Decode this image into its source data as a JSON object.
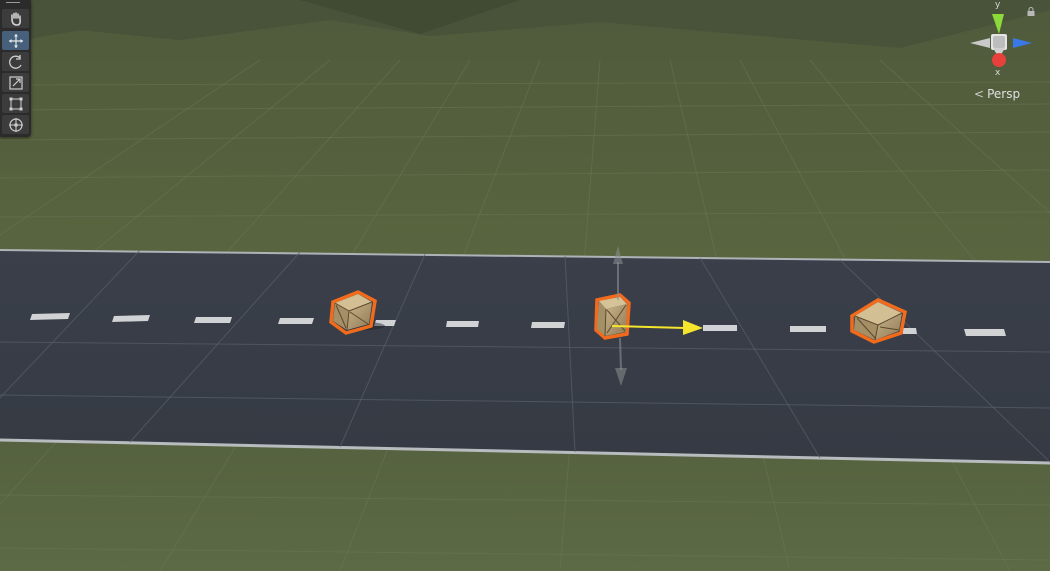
{
  "toolbar": {
    "tools": [
      {
        "name": "hand-tool",
        "icon": "hand-icon",
        "active": false
      },
      {
        "name": "move-tool",
        "icon": "move-icon",
        "active": true
      },
      {
        "name": "rotate-tool",
        "icon": "rotate-icon",
        "active": false
      },
      {
        "name": "scale-tool",
        "icon": "scale-icon",
        "active": false
      },
      {
        "name": "rect-tool",
        "icon": "rect-transform-icon",
        "active": false
      },
      {
        "name": "transform-tool",
        "icon": "transform-icon",
        "active": false
      }
    ]
  },
  "gizmo": {
    "x_label": "x",
    "y_label": "y",
    "projection_label": "Persp",
    "colors": {
      "x": "#e8413b",
      "y": "#8bd93a",
      "z": "#3a78e8"
    }
  },
  "scene": {
    "selected_objects": [
      "crate",
      "crate",
      "crate"
    ],
    "colors": {
      "selection_outline": "#f26b1d",
      "sky": "#5a6640",
      "road": "#3a3f4a",
      "move_handle": "#f5e52d"
    }
  }
}
